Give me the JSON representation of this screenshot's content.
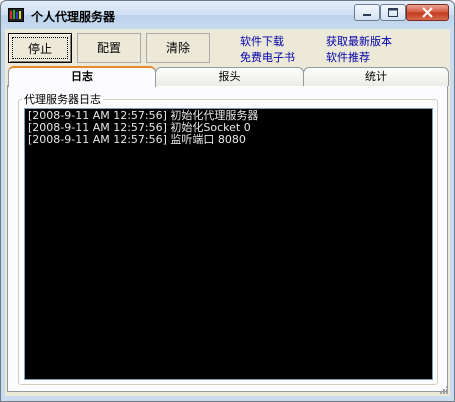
{
  "window": {
    "title": "个人代理服务器"
  },
  "toolbar": {
    "stop_label": "停止",
    "config_label": "配置",
    "clear_label": "清除"
  },
  "links": {
    "download": "软件下载",
    "ebook": "免费电子书",
    "latest": "获取最新版本",
    "recommend": "软件推荐"
  },
  "tabs": [
    {
      "label": "日志"
    },
    {
      "label": "报头"
    },
    {
      "label": "统计"
    }
  ],
  "log_group": {
    "label": "代理服务器日志"
  },
  "log_lines": [
    "[2008-9-11 AM 12:57:56] 初始化代理服务器",
    "[2008-9-11 AM 12:57:56] 初始化Socket 0",
    "[2008-9-11 AM 12:57:56] 监听端口 8080"
  ]
}
